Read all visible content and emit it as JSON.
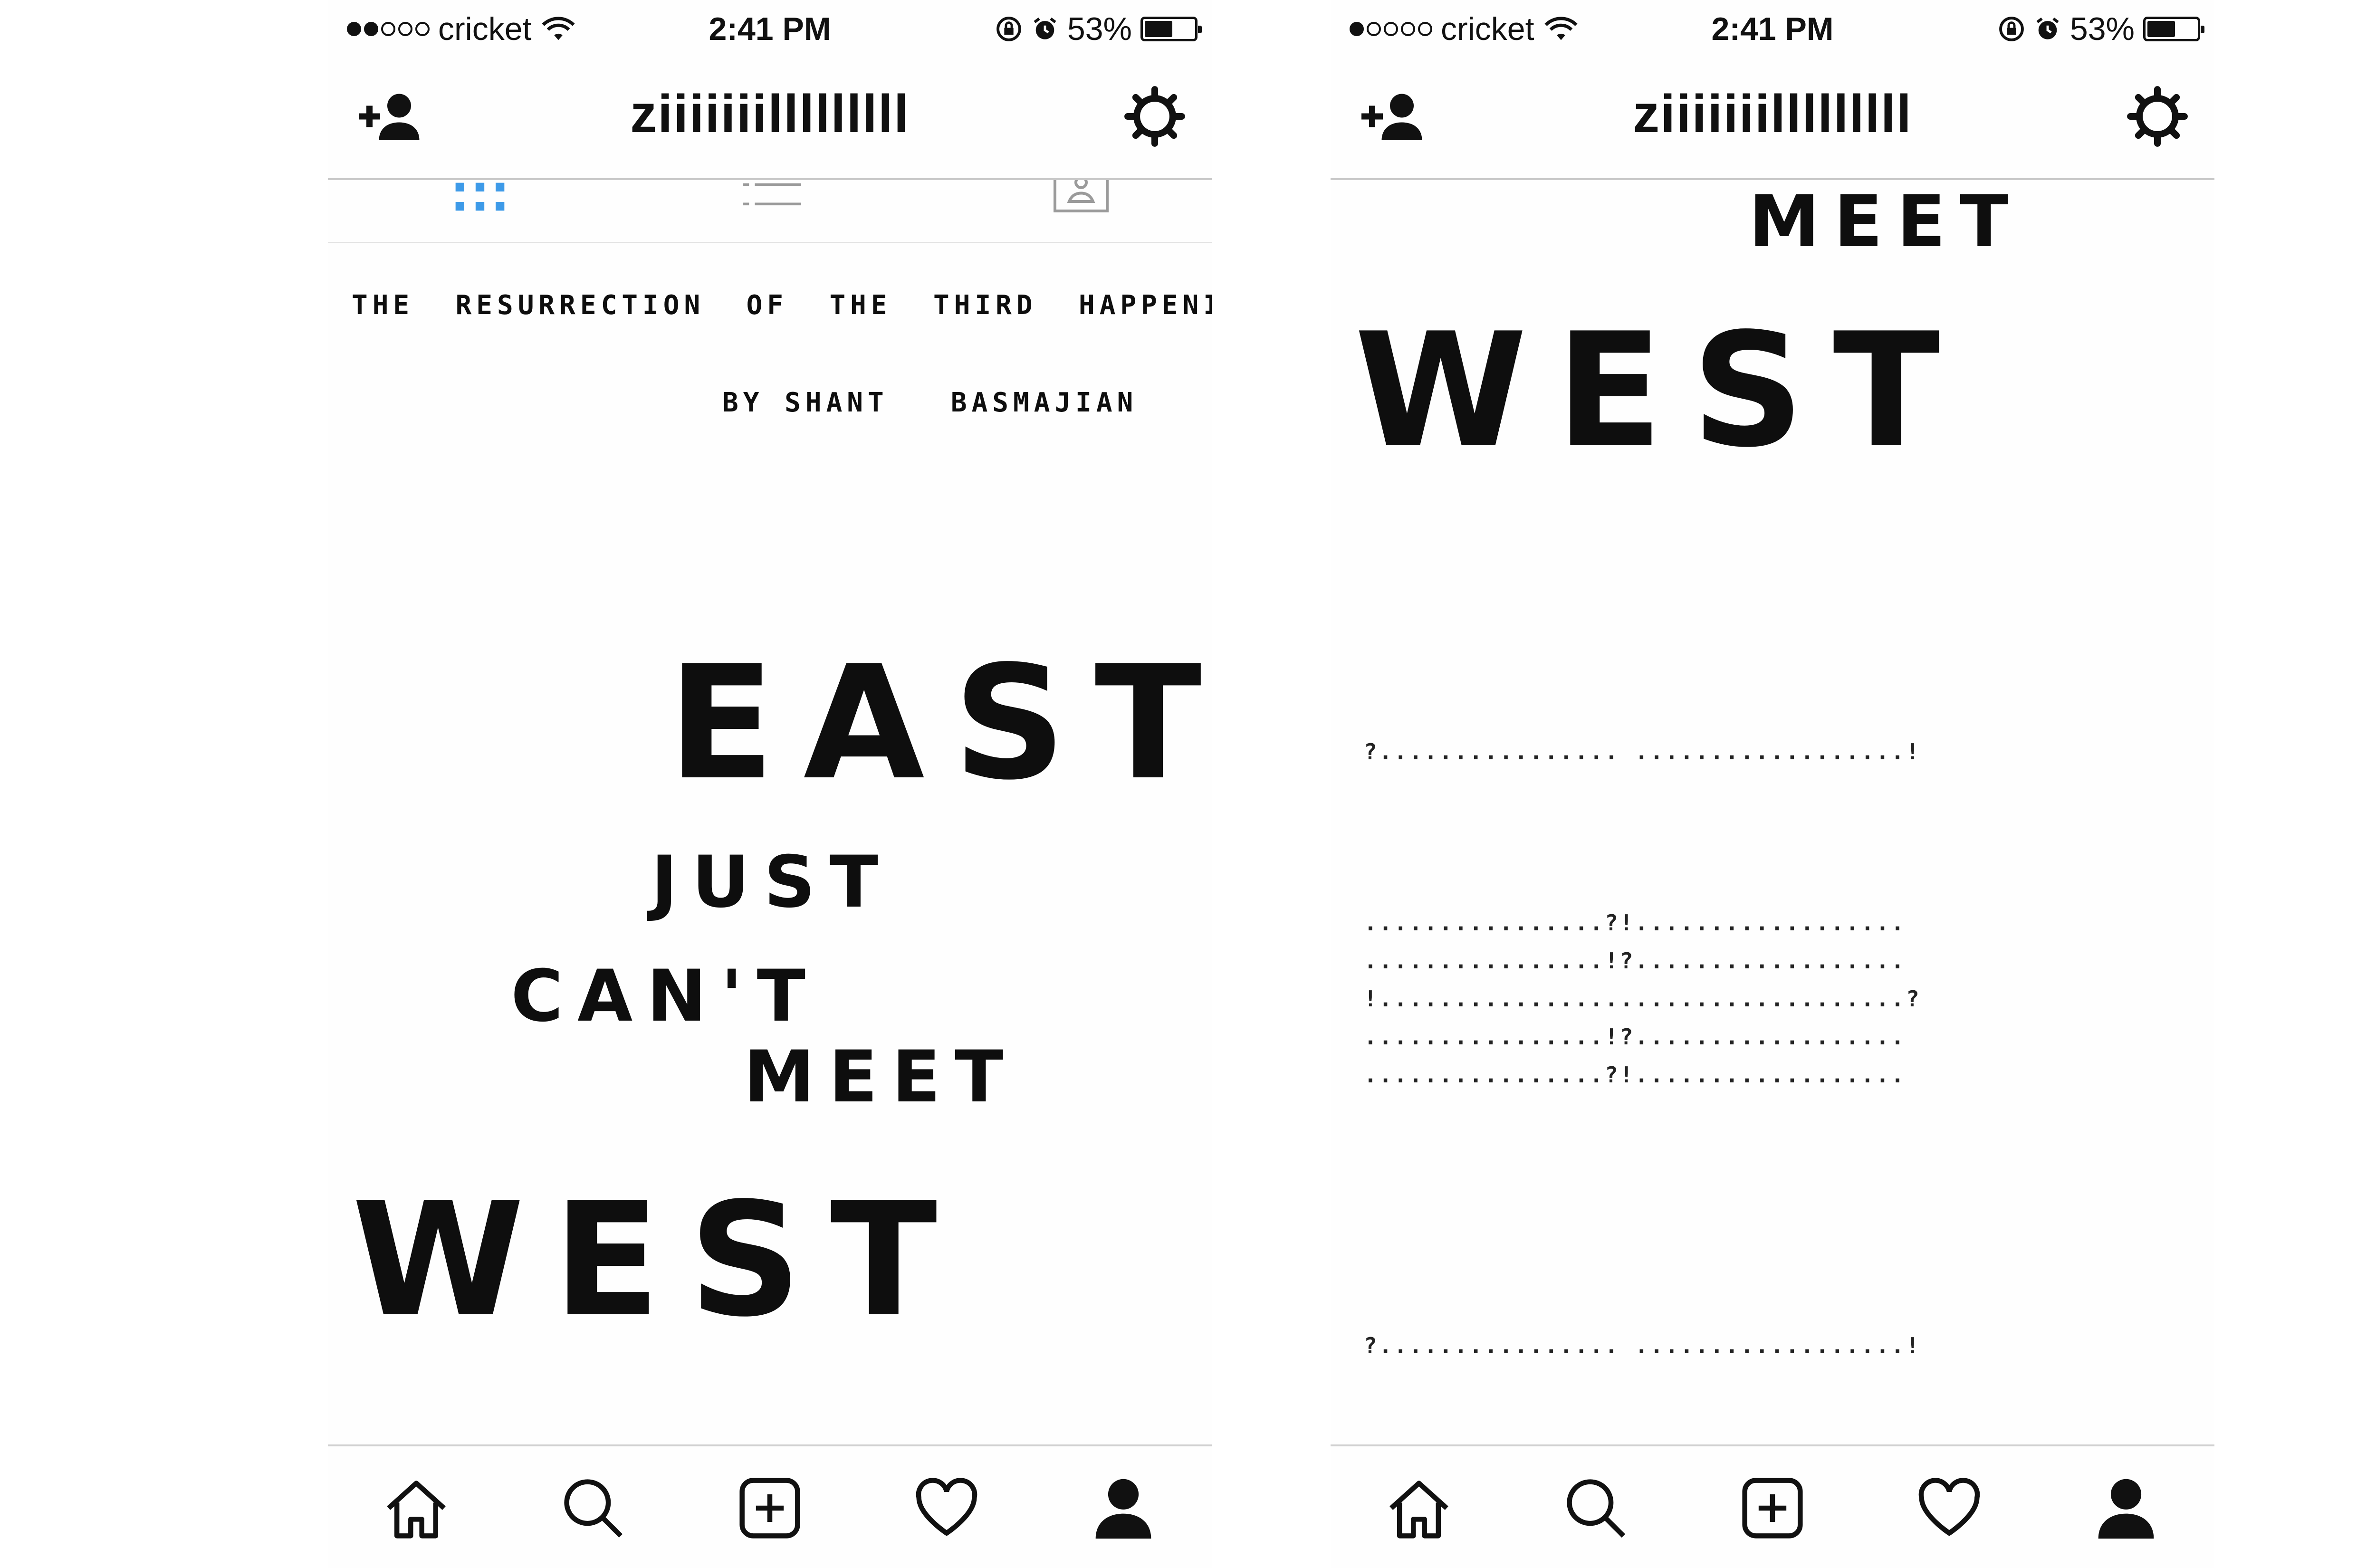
{
  "screens": [
    {
      "status": {
        "signal_filled": 2,
        "signal_total": 5,
        "carrier": "cricket",
        "time": "2:41 PM",
        "battery_percent": "53%",
        "battery_level": 0.53
      },
      "header": {
        "username": "ziiiiiiilllllllll",
        "add_user_icon": "add-user-icon",
        "settings_icon": "gear-icon"
      },
      "view_tabs": [
        "grid",
        "list",
        "tagged"
      ],
      "content": {
        "title_line": "THE  RESURRECTION  OF  THE  THIRD  HAPPENING",
        "byline": "BY SHANT   BASMAJIAN",
        "word_east": "EAST",
        "word_just": "JUST",
        "word_cant": "CAN'T",
        "word_meet": "MEET",
        "word_west": "WEST"
      }
    },
    {
      "status": {
        "signal_filled": 1,
        "signal_total": 5,
        "carrier": "cricket",
        "time": "2:41 PM",
        "battery_percent": "53%",
        "battery_level": 0.53
      },
      "header": {
        "username": "ziiiiiiilllllllll",
        "add_user_icon": "add-user-icon",
        "settings_icon": "gear-icon"
      },
      "content": {
        "word_meet": "MEET",
        "word_west": "WEST",
        "dots_top": "?................ ..................!",
        "dots_block": [
          "................?!..................",
          "................!?..................",
          "!...................................?",
          "................!?..................",
          "................?!.................."
        ],
        "dots_bottom": "?................ ..................!"
      }
    }
  ],
  "tab_bar": [
    {
      "icon": "home-icon"
    },
    {
      "icon": "search-icon"
    },
    {
      "icon": "add-post-icon"
    },
    {
      "icon": "heart-icon"
    },
    {
      "icon": "profile-icon"
    }
  ]
}
